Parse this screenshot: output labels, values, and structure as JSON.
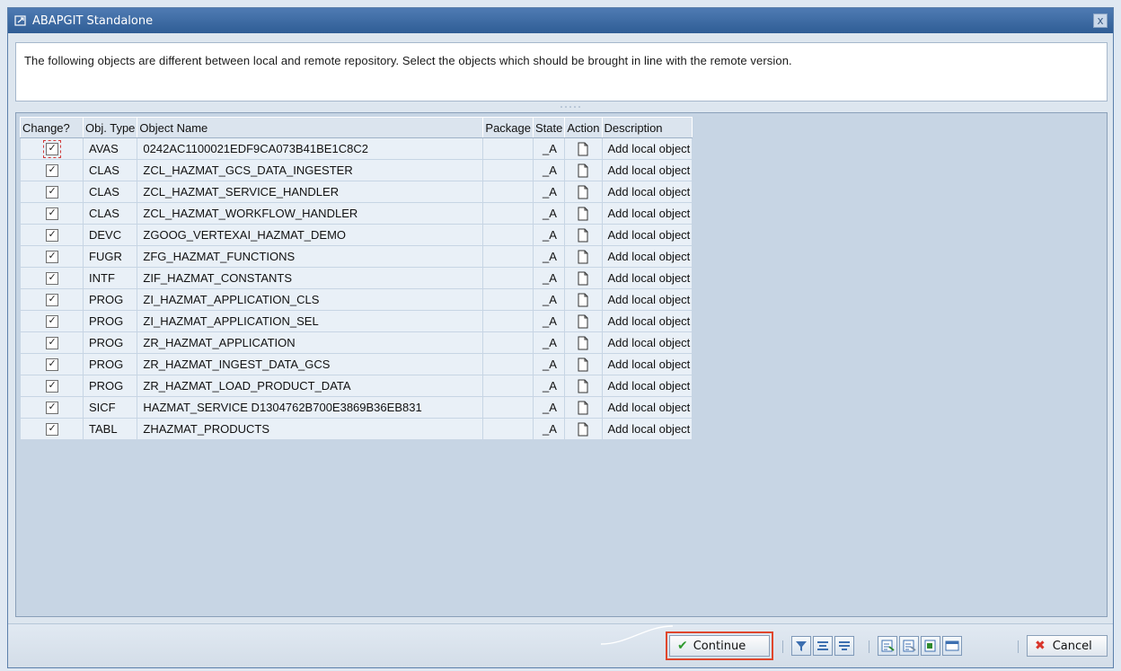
{
  "window": {
    "title": "ABAPGIT Standalone",
    "close_glyph": "x"
  },
  "message": "The following objects are different between local and remote repository. Select the objects which should be brought in line with the remote version.",
  "table": {
    "headers": [
      "Change?",
      "Obj. Type",
      "Object Name",
      "Package",
      "State",
      "Action",
      "Description"
    ],
    "rows": [
      {
        "checked": true,
        "type": "AVAS",
        "name": "0242AC1100021EDF9CA073B41BE1C8C2",
        "package": "",
        "state": "_A",
        "description": "Add local object"
      },
      {
        "checked": true,
        "type": "CLAS",
        "name": "ZCL_HAZMAT_GCS_DATA_INGESTER",
        "package": "",
        "state": "_A",
        "description": "Add local object"
      },
      {
        "checked": true,
        "type": "CLAS",
        "name": "ZCL_HAZMAT_SERVICE_HANDLER",
        "package": "",
        "state": "_A",
        "description": "Add local object"
      },
      {
        "checked": true,
        "type": "CLAS",
        "name": "ZCL_HAZMAT_WORKFLOW_HANDLER",
        "package": "",
        "state": "_A",
        "description": "Add local object"
      },
      {
        "checked": true,
        "type": "DEVC",
        "name": "ZGOOG_VERTEXAI_HAZMAT_DEMO",
        "package": "",
        "state": "_A",
        "description": "Add local object"
      },
      {
        "checked": true,
        "type": "FUGR",
        "name": "ZFG_HAZMAT_FUNCTIONS",
        "package": "",
        "state": "_A",
        "description": "Add local object"
      },
      {
        "checked": true,
        "type": "INTF",
        "name": "ZIF_HAZMAT_CONSTANTS",
        "package": "",
        "state": "_A",
        "description": "Add local object"
      },
      {
        "checked": true,
        "type": "PROG",
        "name": "ZI_HAZMAT_APPLICATION_CLS",
        "package": "",
        "state": "_A",
        "description": "Add local object"
      },
      {
        "checked": true,
        "type": "PROG",
        "name": "ZI_HAZMAT_APPLICATION_SEL",
        "package": "",
        "state": "_A",
        "description": "Add local object"
      },
      {
        "checked": true,
        "type": "PROG",
        "name": "ZR_HAZMAT_APPLICATION",
        "package": "",
        "state": "_A",
        "description": "Add local object"
      },
      {
        "checked": true,
        "type": "PROG",
        "name": "ZR_HAZMAT_INGEST_DATA_GCS",
        "package": "",
        "state": "_A",
        "description": "Add local object"
      },
      {
        "checked": true,
        "type": "PROG",
        "name": "ZR_HAZMAT_LOAD_PRODUCT_DATA",
        "package": "",
        "state": "_A",
        "description": "Add local object"
      },
      {
        "checked": true,
        "type": "SICF",
        "name": "HAZMAT_SERVICE D1304762B700E3869B36EB831",
        "package": "",
        "state": "_A",
        "description": "Add local object"
      },
      {
        "checked": true,
        "type": "TABL",
        "name": "ZHAZMAT_PRODUCTS",
        "package": "",
        "state": "_A",
        "description": "Add local object"
      }
    ]
  },
  "footer": {
    "continue_label": "Continue",
    "cancel_label": "Cancel"
  },
  "colors": {
    "titlebar": "#3d6aa3",
    "highlight_outline": "#e0462c",
    "continue_check": "#2e9a2e",
    "cancel_x": "#d9362b"
  }
}
